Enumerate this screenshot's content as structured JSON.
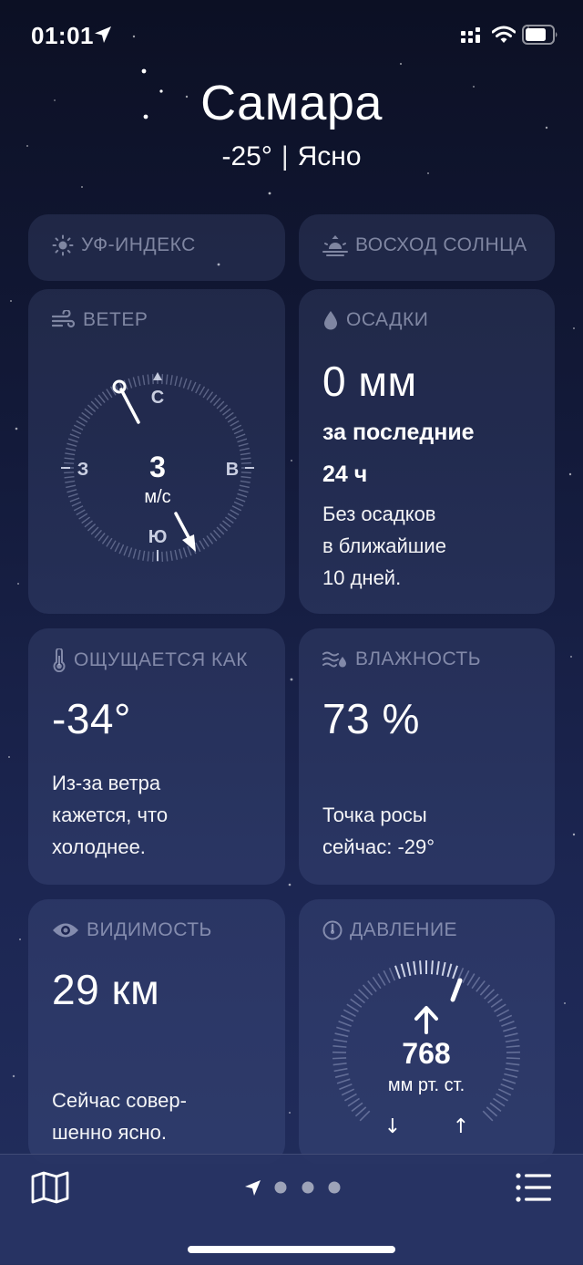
{
  "status_bar": {
    "time": "01:01"
  },
  "header": {
    "city": "Самара",
    "temperature": "-25°",
    "separator": "|",
    "condition": "Ясно"
  },
  "uv_card": {
    "title": "УФ-ИНДЕКС",
    "icon": "sun-icon"
  },
  "sunrise_card": {
    "title": "ВОСХОД СОЛНЦА",
    "icon": "sunrise-icon"
  },
  "wind_card": {
    "title": "ВЕТЕР",
    "icon": "wind-icon",
    "speed": "3",
    "unit": "м/с",
    "compass": {
      "north": "С",
      "east": "В",
      "south": "Ю",
      "west": "З"
    }
  },
  "precip_card": {
    "title": "ОСАДКИ",
    "icon": "raindrop-icon",
    "value": "0 мм",
    "period_line1": "за последние",
    "period_line2": "24 ч",
    "desc_line1": "Без осадков",
    "desc_line2": "в ближайшие",
    "desc_line3": "10 дней."
  },
  "feels_card": {
    "title": "ОЩУЩАЕТСЯ КАК",
    "icon": "thermometer-icon",
    "value": "-34°",
    "desc_line1": "Из-за ветра",
    "desc_line2": "кажется, что",
    "desc_line3": "холоднее."
  },
  "humidity_card": {
    "title": "ВЛАЖНОСТЬ",
    "icon": "humidity-icon",
    "value": "73 %",
    "desc_line1": "Точка росы",
    "desc_line2": "сейчас: -29°"
  },
  "visibility_card": {
    "title": "ВИДИМОСТЬ",
    "icon": "eye-icon",
    "value": "29 км",
    "desc_line1": "Сейчас совер-",
    "desc_line2": "шенно ясно."
  },
  "pressure_card": {
    "title": "ДАВЛЕНИЕ",
    "icon": "gauge-icon",
    "value": "768",
    "unit": "мм рт. ст.",
    "low_arrow": "↓",
    "high_arrow": "↑"
  },
  "bottom_bar": {
    "map_icon": "map-icon",
    "location_icon": "location-arrow-icon",
    "list_icon": "list-icon",
    "page_count": 3
  }
}
